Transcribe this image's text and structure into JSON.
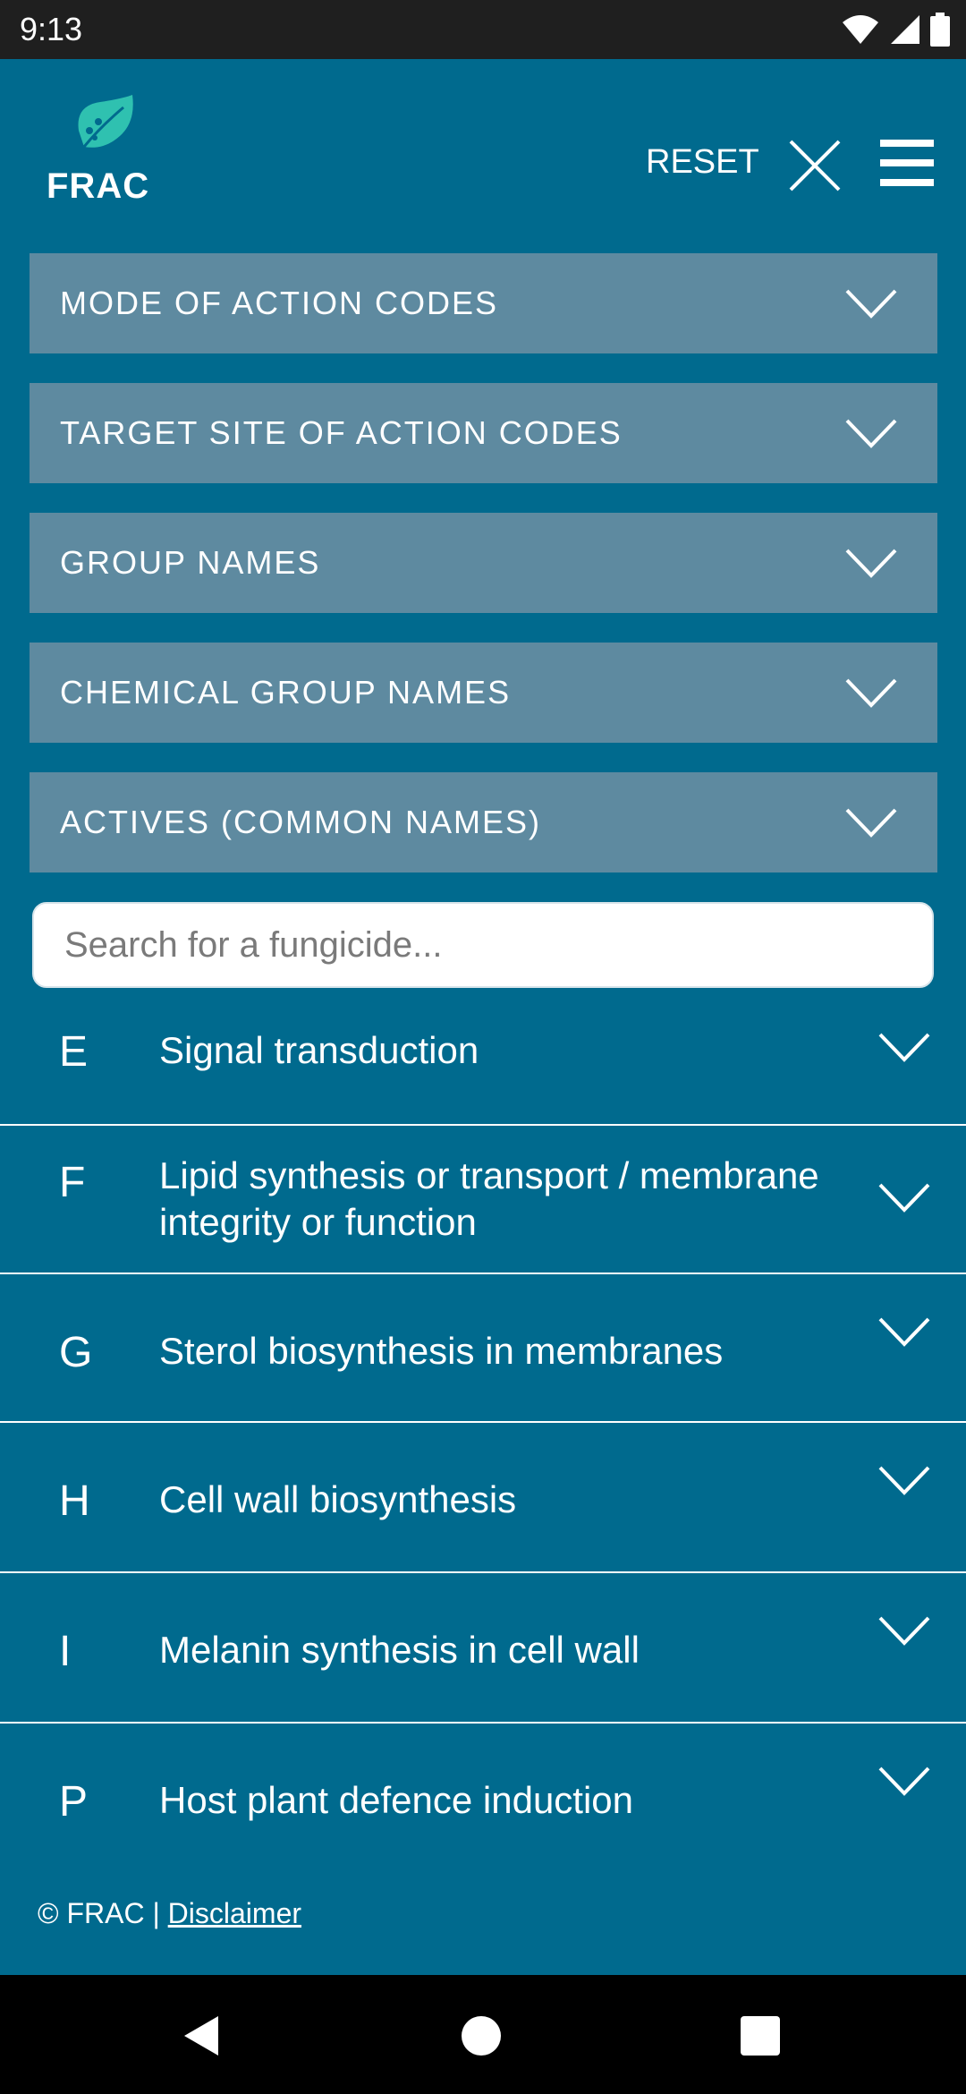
{
  "status_bar": {
    "time": "9:13",
    "icons": [
      "wifi-icon",
      "signal-icon",
      "battery-icon"
    ]
  },
  "header": {
    "logo_text": "FRAC",
    "reset_label": "RESET",
    "close_icon": "close-icon",
    "menu_icon": "hamburger-menu-icon"
  },
  "filters": [
    {
      "label": "MODE OF ACTION CODES"
    },
    {
      "label": "TARGET SITE OF ACTION CODES"
    },
    {
      "label": "GROUP NAMES"
    },
    {
      "label": "CHEMICAL GROUP NAMES"
    },
    {
      "label": "ACTIVES (COMMON NAMES)"
    }
  ],
  "search": {
    "placeholder": "Search for a fungicide...",
    "value": ""
  },
  "list": [
    {
      "code": "E",
      "title": "Signal transduction"
    },
    {
      "code": "F",
      "title": "Lipid synthesis or transport / membrane integrity or function"
    },
    {
      "code": "G",
      "title": "Sterol biosynthesis in membranes"
    },
    {
      "code": "H",
      "title": "Cell wall biosynthesis"
    },
    {
      "code": "I",
      "title": "Melanin synthesis in cell wall"
    },
    {
      "code": "P",
      "title": "Host plant defence induction"
    }
  ],
  "footer": {
    "copyright": "© FRAC |",
    "disclaimer_label": "Disclaimer"
  },
  "colors": {
    "background": "#006a8e",
    "filter_background": "#5e8aa0",
    "logo_accent": "#2fc1b0"
  }
}
